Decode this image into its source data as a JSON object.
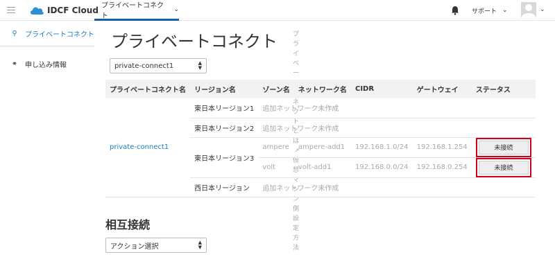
{
  "header": {
    "logo_text": "IDCF Cloud",
    "nav_tab": "プライベートコネクト",
    "support": "サポート"
  },
  "sidebar": {
    "items": [
      {
        "label": "プライベートコネクト",
        "active": true
      },
      {
        "label": "申し込み情報",
        "active": false
      }
    ]
  },
  "main": {
    "title": "プライベートコネクト",
    "help_link_1": "プライベートコネクトとは",
    "help_link_2": "仮想マシン側設定方法",
    "connection_select": "private-connect1",
    "table": {
      "headers": [
        "プライベートコネクト名",
        "リージョン名",
        "ゾーン名",
        "ネットワーク名",
        "CIDR",
        "ゲートウェイ",
        "ステータス"
      ],
      "connection_name": "private-connect1",
      "rows": [
        {
          "region": "東日本リージョン1",
          "note": "追加ネットワーク未作成"
        },
        {
          "region": "東日本リージョン2",
          "note": "追加ネットワーク未作成"
        },
        {
          "region": "東日本リージョン3",
          "zone": "ampere",
          "network": "ampere-add1",
          "cidr": "192.168.1.0/24",
          "gateway": "192.168.1.254",
          "status": "未接続"
        },
        {
          "zone": "volt",
          "network": "volt-add1",
          "cidr": "192.168.0.0/24",
          "gateway": "192.168.0.254",
          "status": "未接続"
        },
        {
          "region": "西日本リージョン",
          "note": "追加ネットワーク未作成"
        }
      ]
    },
    "section_title": "相互接続",
    "action_select": "アクション選択"
  },
  "colors": {
    "accent": "#1a7ebf",
    "nav_underline": "#1a5fa8",
    "highlight": "#d0021b"
  }
}
